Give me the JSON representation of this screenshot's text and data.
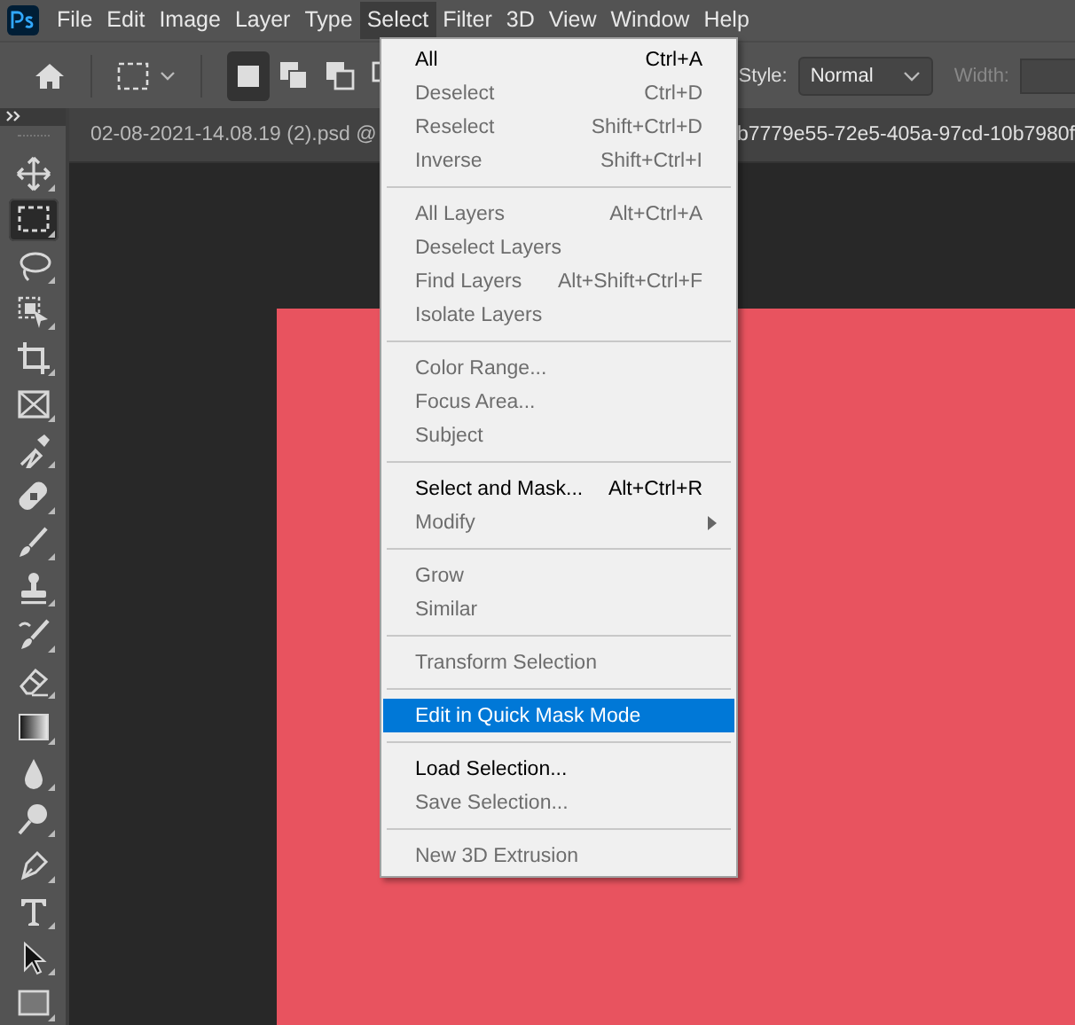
{
  "menu_bar": {
    "items": [
      {
        "label": "File",
        "selected": false
      },
      {
        "label": "Edit",
        "selected": false
      },
      {
        "label": "Image",
        "selected": false
      },
      {
        "label": "Layer",
        "selected": false
      },
      {
        "label": "Type",
        "selected": false
      },
      {
        "label": "Select",
        "selected": true
      },
      {
        "label": "Filter",
        "selected": false
      },
      {
        "label": "3D",
        "selected": false
      },
      {
        "label": "View",
        "selected": false
      },
      {
        "label": "Window",
        "selected": false
      },
      {
        "label": "Help",
        "selected": false
      }
    ]
  },
  "options_bar": {
    "modes": [
      {
        "kind": "new",
        "selected": true
      },
      {
        "kind": "add",
        "selected": false
      },
      {
        "kind": "subtract",
        "selected": false
      },
      {
        "kind": "intersect",
        "selected": false
      }
    ],
    "style_label": "Style:",
    "style_value": "Normal",
    "width_label": "Width:"
  },
  "document_tab": {
    "title_start": "02-08-2021-14.08.19 (2).psd @",
    "title_end": "b7779e55-72e5-405a-97cd-10b7980f"
  },
  "toolbar": {
    "tools": [
      {
        "kind": "move",
        "selected": false
      },
      {
        "kind": "marquee",
        "selected": true
      },
      {
        "kind": "lasso",
        "selected": false
      },
      {
        "kind": "object",
        "selected": false
      },
      {
        "kind": "crop",
        "selected": false
      },
      {
        "kind": "frame",
        "selected": false
      },
      {
        "kind": "eyedropper",
        "selected": false
      },
      {
        "kind": "healing",
        "selected": false
      },
      {
        "kind": "brush",
        "selected": false
      },
      {
        "kind": "stamp",
        "selected": false
      },
      {
        "kind": "history",
        "selected": false
      },
      {
        "kind": "eraser",
        "selected": false
      },
      {
        "kind": "gradient",
        "selected": false
      },
      {
        "kind": "blur",
        "selected": false
      },
      {
        "kind": "dodge",
        "selected": false
      },
      {
        "kind": "pen",
        "selected": false
      },
      {
        "kind": "type",
        "selected": false
      },
      {
        "kind": "path",
        "selected": false
      },
      {
        "kind": "rectangle",
        "selected": false
      }
    ]
  },
  "select_menu": {
    "groups": [
      [
        {
          "label": "All",
          "shortcut": "Ctrl+A",
          "disabled": false,
          "selected": false
        },
        {
          "label": "Deselect",
          "shortcut": "Ctrl+D",
          "disabled": true,
          "selected": false
        },
        {
          "label": "Reselect",
          "shortcut": "Shift+Ctrl+D",
          "disabled": true,
          "selected": false
        },
        {
          "label": "Inverse",
          "shortcut": "Shift+Ctrl+I",
          "disabled": true,
          "selected": false
        }
      ],
      [
        {
          "label": "All Layers",
          "shortcut": "Alt+Ctrl+A",
          "disabled": true,
          "selected": false
        },
        {
          "label": "Deselect Layers",
          "disabled": true,
          "selected": false
        },
        {
          "label": "Find Layers",
          "shortcut": "Alt+Shift+Ctrl+F",
          "disabled": true,
          "selected": false
        },
        {
          "label": "Isolate Layers",
          "disabled": true,
          "selected": false
        }
      ],
      [
        {
          "label": "Color Range...",
          "disabled": true,
          "selected": false
        },
        {
          "label": "Focus Area...",
          "disabled": true,
          "selected": false
        },
        {
          "label": "Subject",
          "disabled": true,
          "selected": false
        }
      ],
      [
        {
          "label": "Select and Mask...",
          "shortcut": "Alt+Ctrl+R",
          "disabled": false,
          "selected": false
        },
        {
          "label": "Modify",
          "disabled": true,
          "selected": false,
          "submenu": true
        }
      ],
      [
        {
          "label": "Grow",
          "disabled": true,
          "selected": false
        },
        {
          "label": "Similar",
          "disabled": true,
          "selected": false
        }
      ],
      [
        {
          "label": "Transform Selection",
          "disabled": true,
          "selected": false
        }
      ],
      [
        {
          "label": "Edit in Quick Mask Mode",
          "disabled": false,
          "selected": true
        }
      ],
      [
        {
          "label": "Load Selection...",
          "disabled": false,
          "selected": false
        },
        {
          "label": "Save Selection...",
          "disabled": true,
          "selected": false
        }
      ],
      [
        {
          "label": "New 3D Extrusion",
          "disabled": true,
          "selected": false
        }
      ]
    ]
  }
}
